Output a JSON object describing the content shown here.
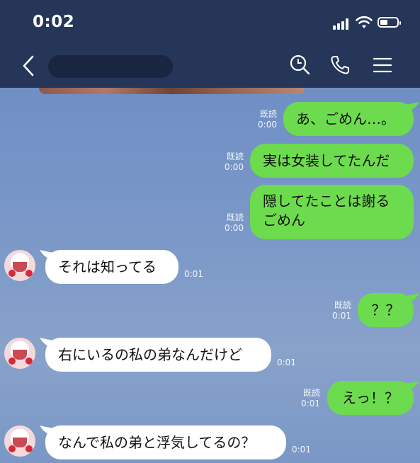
{
  "status_bar": {
    "time": "0:02"
  },
  "header": {
    "contact_name": ""
  },
  "messages": [
    {
      "side": "out",
      "text": "あ、ごめん…。",
      "read": "既読",
      "time": "0:00"
    },
    {
      "side": "out",
      "text": "実は女装してたんだ",
      "read": "既読",
      "time": "0:00"
    },
    {
      "side": "out",
      "text": "隠してたことは謝る\nごめん",
      "read": "既読",
      "time": "0:00"
    },
    {
      "side": "in",
      "text": "それは知ってる",
      "time": "0:01"
    },
    {
      "side": "out",
      "text": "？？",
      "read": "既読",
      "time": "0:01"
    },
    {
      "side": "in",
      "text": "右にいるの私の弟なんだけど",
      "time": "0:01"
    },
    {
      "side": "out",
      "text": "えっ！？",
      "read": "既読",
      "time": "0:01"
    },
    {
      "side": "in",
      "text": "なんで私の弟と浮気してるの？",
      "time": "0:01"
    }
  ],
  "colors": {
    "header_bg": "#263659",
    "outgoing_bubble": "#6ddb4e",
    "incoming_bubble": "#ffffff",
    "chat_bg": "#7894c2"
  },
  "icons": [
    "back-chevron-icon",
    "search-icon",
    "phone-icon",
    "menu-icon",
    "signal-icon",
    "wifi-icon",
    "battery-icon"
  ]
}
